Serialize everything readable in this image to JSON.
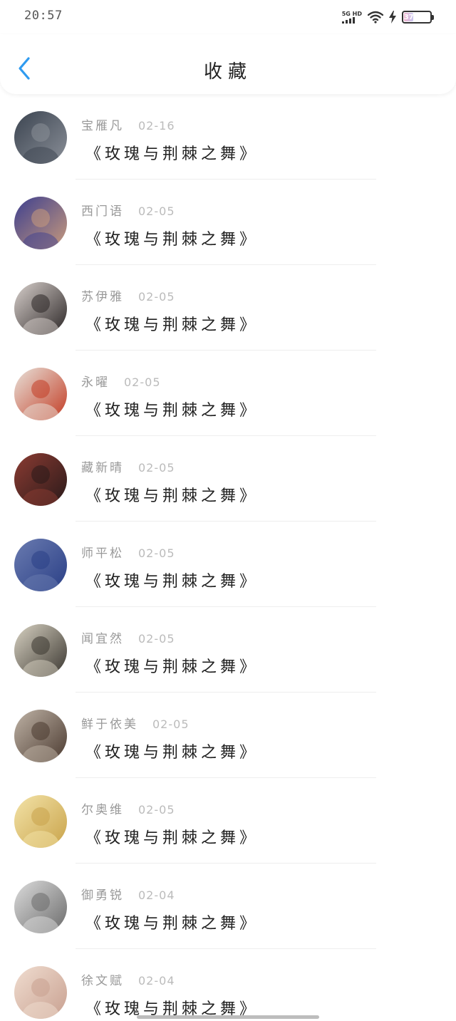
{
  "status_bar": {
    "time": "20:57",
    "network": "5G HD",
    "battery": "37",
    "battery_level": 0.37
  },
  "header": {
    "title": "收藏"
  },
  "items": [
    {
      "name": "宝雁凡",
      "date": "02-16",
      "title": "《玫瑰与荆棘之舞》",
      "avatar_colors": [
        "#3b4450",
        "#8a8f98"
      ]
    },
    {
      "name": "西门语",
      "date": "02-05",
      "title": "《玫瑰与荆棘之舞》",
      "avatar_colors": [
        "#3d3f8f",
        "#c89a7c"
      ]
    },
    {
      "name": "苏伊雅",
      "date": "02-05",
      "title": "《玫瑰与荆棘之舞》",
      "avatar_colors": [
        "#d8d0cc",
        "#2b2626"
      ]
    },
    {
      "name": "永曜",
      "date": "02-05",
      "title": "《玫瑰与荆棘之舞》",
      "avatar_colors": [
        "#e8e2da",
        "#c33c24"
      ]
    },
    {
      "name": "藏新晴",
      "date": "02-05",
      "title": "《玫瑰与荆棘之舞》",
      "avatar_colors": [
        "#8b3b32",
        "#2a1a1a"
      ]
    },
    {
      "name": "师平松",
      "date": "02-05",
      "title": "《玫瑰与荆棘之舞》",
      "avatar_colors": [
        "#6a7bb0",
        "#2a3f86"
      ]
    },
    {
      "name": "闻宜然",
      "date": "02-05",
      "title": "《玫瑰与荆棘之舞》",
      "avatar_colors": [
        "#d8d2c2",
        "#3a3630"
      ]
    },
    {
      "name": "鲜于依美",
      "date": "02-05",
      "title": "《玫瑰与荆棘之舞》",
      "avatar_colors": [
        "#bfb3a6",
        "#4b3a30"
      ]
    },
    {
      "name": "尔奥维",
      "date": "02-05",
      "title": "《玫瑰与荆棘之舞》",
      "avatar_colors": [
        "#f3e3a8",
        "#c9a34a"
      ]
    },
    {
      "name": "御勇锐",
      "date": "02-04",
      "title": "《玫瑰与荆棘之舞》",
      "avatar_colors": [
        "#dcdcdc",
        "#6b6b6b"
      ]
    },
    {
      "name": "徐文赋",
      "date": "02-04",
      "title": "《玫瑰与荆棘之舞》",
      "avatar_colors": [
        "#f0ddd0",
        "#c8a090"
      ]
    }
  ],
  "icons": {
    "back": "chevron-left-icon",
    "wifi": "wifi-icon",
    "charging": "lightning-icon",
    "signal": "signal-bars-icon"
  },
  "accent_color": "#2f9bf0"
}
